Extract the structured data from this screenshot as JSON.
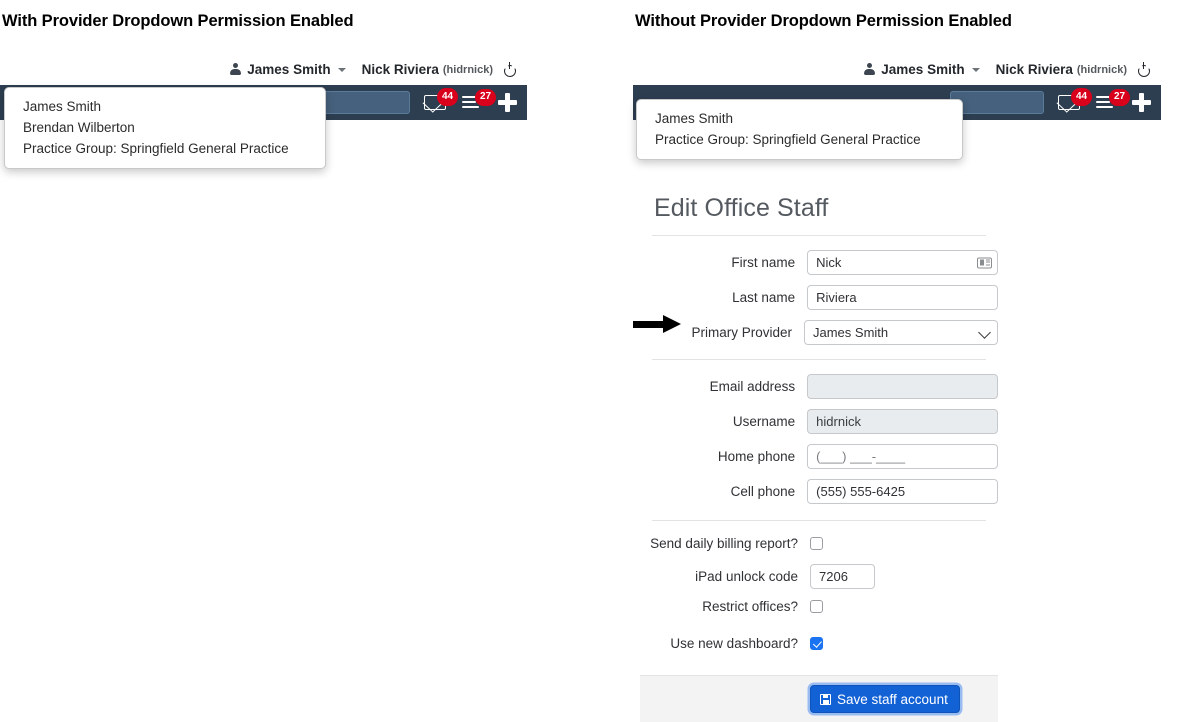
{
  "panels": {
    "left": {
      "caption": "With Provider Dropdown Permission Enabled",
      "topbar": {
        "provider_label": "James Smith",
        "person_icon": "person-icon",
        "caret_icon": "chevron-down-icon",
        "user_name": "Nick Riviera",
        "user_handle": "(hidrnick)",
        "power_icon": "power-icon"
      },
      "navbar": {
        "search_value": "",
        "mail_icon": "envelope-icon",
        "mail_badge": "44",
        "list_icon": "list-icon",
        "list_badge": "27",
        "plus_icon": "plus-icon"
      },
      "provider_dropdown": {
        "items": [
          "James Smith",
          "Brendan Wilberton",
          "Practice Group: Springfield General Practice"
        ]
      }
    },
    "right": {
      "caption": "Without Provider Dropdown Permission Enabled",
      "topbar": {
        "provider_label": "James Smith",
        "person_icon": "person-icon",
        "caret_icon": "chevron-down-icon",
        "user_name": "Nick Riviera",
        "user_handle": "(hidrnick)",
        "power_icon": "power-icon"
      },
      "navbar": {
        "search_value": "",
        "mail_icon": "envelope-icon",
        "mail_badge": "44",
        "list_icon": "list-icon",
        "list_badge": "27",
        "plus_icon": "plus-icon"
      },
      "provider_dropdown": {
        "items": [
          "James Smith",
          "Practice Group: Springfield General Practice"
        ]
      },
      "form": {
        "heading": "Edit Office Staff",
        "fields": {
          "first_name": {
            "label": "First name",
            "value": "Nick",
            "icon": "address-card-icon"
          },
          "last_name": {
            "label": "Last name",
            "value": "Riviera"
          },
          "primary_provider": {
            "label": "Primary Provider",
            "value": "James Smith",
            "options": [
              "James Smith"
            ]
          },
          "email": {
            "label": "Email address",
            "value": ""
          },
          "username": {
            "label": "Username",
            "value": "hidrnick"
          },
          "home_phone": {
            "label": "Home phone",
            "placeholder": "(___) ___-____",
            "value": ""
          },
          "cell_phone": {
            "label": "Cell phone",
            "value": "(555) 555-6425"
          },
          "daily_billing": {
            "label": "Send daily billing report?",
            "checked": false
          },
          "ipad_code": {
            "label": "iPad unlock code",
            "value": "7206"
          },
          "restrict_offices": {
            "label": "Restrict offices?",
            "checked": false
          },
          "new_dashboard": {
            "label": "Use new dashboard?",
            "checked": true
          }
        },
        "save_button": {
          "label": "Save staff account",
          "icon": "floppy-disk-icon"
        }
      },
      "annotation": {
        "arrow": "right-arrow-pointer"
      }
    }
  },
  "colors": {
    "navbar_bg": "#2c3e50",
    "badge_red": "#d9001b",
    "save_blue": "#1262d6",
    "checkbox_blue": "#1a73f0",
    "heading_gray": "#555a60",
    "disabled_bg": "#e9ecef"
  }
}
